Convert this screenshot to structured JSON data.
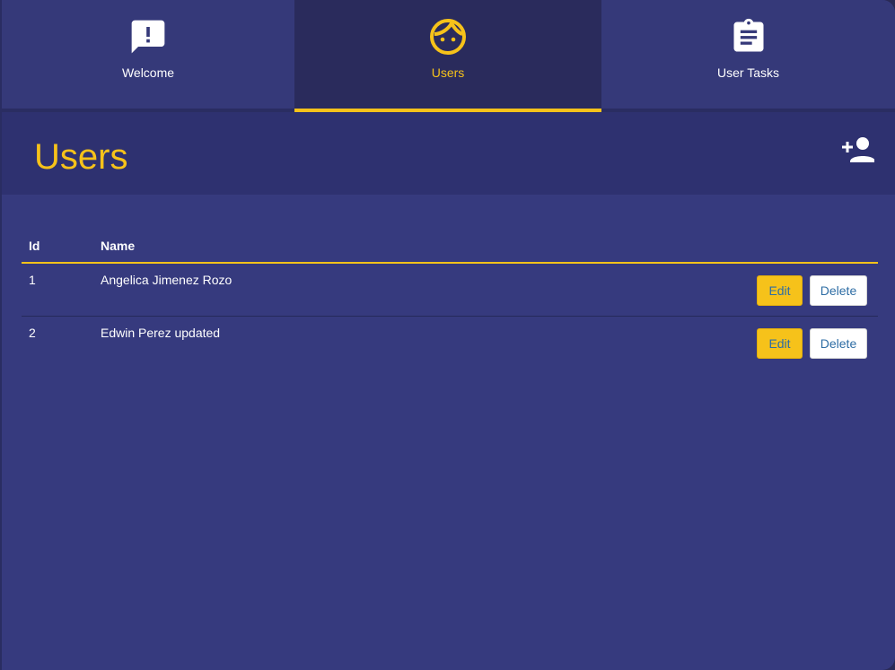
{
  "tabs": [
    {
      "label": "Welcome",
      "icon": "feedback-icon"
    },
    {
      "label": "Users",
      "icon": "face-icon"
    },
    {
      "label": "User Tasks",
      "icon": "clipboard-icon"
    }
  ],
  "active_tab": "Users",
  "header": {
    "title": "Users",
    "add_icon": "person-add-icon"
  },
  "table": {
    "columns": [
      "Id",
      "Name"
    ],
    "rows": [
      {
        "id": "1",
        "name": "Angelica Jimenez Rozo",
        "edit_label": "Edit",
        "delete_label": "Delete"
      },
      {
        "id": "2",
        "name": "Edwin Perez updated",
        "edit_label": "Edit",
        "delete_label": "Delete"
      }
    ]
  },
  "colors": {
    "accent": "#f6c21a",
    "background": "#363a7e",
    "active_tab": "#2a2b5c",
    "header": "#2e3170",
    "button_text": "#2e6da4"
  }
}
